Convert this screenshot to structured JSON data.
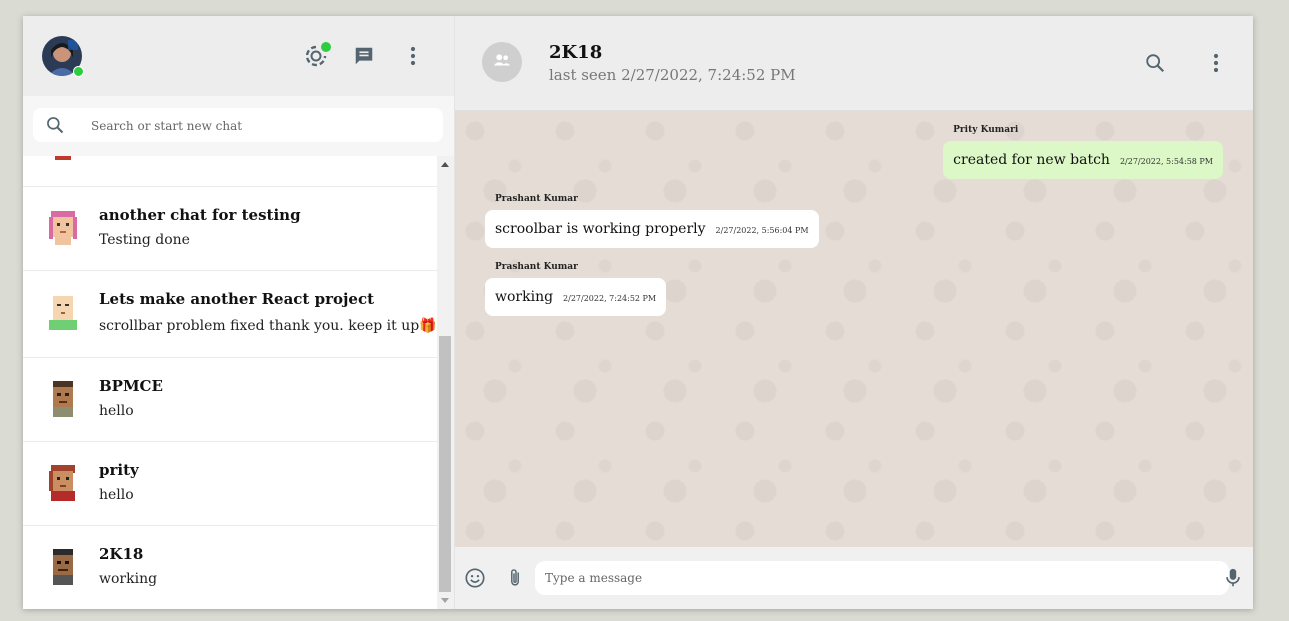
{
  "sidebar": {
    "search_placeholder": "Search or start new chat",
    "partial_top_preview": "😆😆😆😆😆",
    "chats": [
      {
        "name": "another chat for testing",
        "last_message": "Testing done"
      },
      {
        "name": "Lets make another React project",
        "last_message": "scrollbar problem fixed thank you. keep it up🎁"
      },
      {
        "name": "BPMCE",
        "last_message": "hello"
      },
      {
        "name": "prity",
        "last_message": "hello"
      },
      {
        "name": "2K18",
        "last_message": "working"
      }
    ]
  },
  "chat": {
    "title": "2K18",
    "last_seen": "last seen 2/27/2022, 7:24:52 PM",
    "messages": [
      {
        "sender": "Prity Kumari",
        "text": "created for new batch",
        "time": "2/27/2022, 5:54:58 PM",
        "mine": true
      },
      {
        "sender": "Prashant Kumar",
        "text": "scroolbar is working properly",
        "time": "2/27/2022, 5:56:04 PM",
        "mine": false
      },
      {
        "sender": "Prashant Kumar",
        "text": "working",
        "time": "2/27/2022, 7:24:52 PM",
        "mine": false
      }
    ],
    "input_placeholder": "Type a message"
  },
  "icons": {
    "status": "status-icon",
    "new_chat": "new-chat-icon",
    "menu": "more-vert-icon",
    "search": "search-icon",
    "emoji": "emoji-icon",
    "attach": "attach-icon",
    "mic": "mic-icon",
    "group": "group-icon"
  },
  "colors": {
    "sent_bubble": "#dcf8c6",
    "received_bubble": "#ffffff",
    "chat_background": "#e5ddd5",
    "online": "#2ecc40"
  }
}
